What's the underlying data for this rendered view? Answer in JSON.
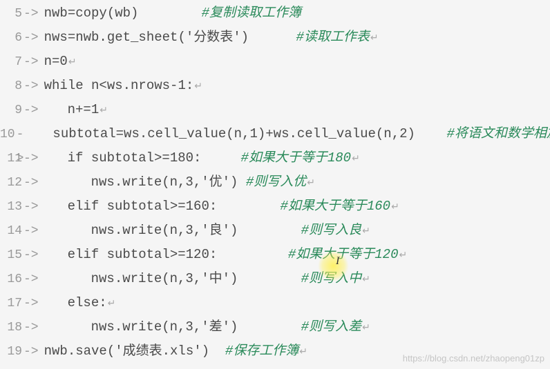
{
  "lines": [
    {
      "num": "5",
      "indent": 0,
      "code": "nwb=copy(wb)",
      "spacer": "        ",
      "comment": "#复制读取工作簿"
    },
    {
      "num": "6",
      "indent": 0,
      "code": "nws=nwb.get_sheet('分数表')",
      "spacer": "      ",
      "comment": "#读取工作表",
      "marker": true
    },
    {
      "num": "7",
      "indent": 0,
      "code": "n=0",
      "spacer": "",
      "comment": "",
      "marker": true
    },
    {
      "num": "8",
      "indent": 0,
      "code": "while n<ws.nrows-1:",
      "spacer": "",
      "comment": "",
      "marker": true
    },
    {
      "num": "9",
      "indent": 1,
      "code": "n+=1",
      "spacer": "",
      "comment": "",
      "marker": true
    },
    {
      "num": "10",
      "indent": 1,
      "code": "subtotal=ws.cell_value(n,1)+ws.cell_value(n,2)",
      "spacer": "    ",
      "comment": "#将语文和数学相加",
      "marker": true
    },
    {
      "num": "11",
      "indent": 1,
      "code": "if subtotal>=180:",
      "spacer": "     ",
      "comment": "#如果大于等于180",
      "marker": true
    },
    {
      "num": "12",
      "indent": 2,
      "code": "nws.write(n,3,'优')",
      "spacer": " ",
      "comment": "#则写入优",
      "marker": true
    },
    {
      "num": "13",
      "indent": 1,
      "code": "elif subtotal>=160:",
      "spacer": "        ",
      "comment": "#如果大于等于160",
      "marker": true
    },
    {
      "num": "14",
      "indent": 2,
      "code": "nws.write(n,3,'良')",
      "spacer": "        ",
      "comment": "#则写入良",
      "marker": true
    },
    {
      "num": "15",
      "indent": 1,
      "code": "elif subtotal>=120:",
      "spacer": "         ",
      "comment": "#如果大于等于120",
      "marker": true
    },
    {
      "num": "16",
      "indent": 2,
      "code": "nws.write(n,3,'中')",
      "spacer": "        ",
      "comment": "#则写入中",
      "marker": true
    },
    {
      "num": "17",
      "indent": 1,
      "code": "else:",
      "spacer": "",
      "comment": "",
      "marker": true
    },
    {
      "num": "18",
      "indent": 2,
      "code": "nws.write(n,3,'差')",
      "spacer": "        ",
      "comment": "#则写入差",
      "marker": true
    },
    {
      "num": "19",
      "indent": 0,
      "code": "nwb.save('成绩表.xls')",
      "spacer": "  ",
      "comment": "#保存工作簿",
      "marker": true
    }
  ],
  "watermark": "https://blog.csdn.net/zhaopeng01zp",
  "arrow": "->",
  "cursor_char": "I",
  "newline_char": "↵"
}
